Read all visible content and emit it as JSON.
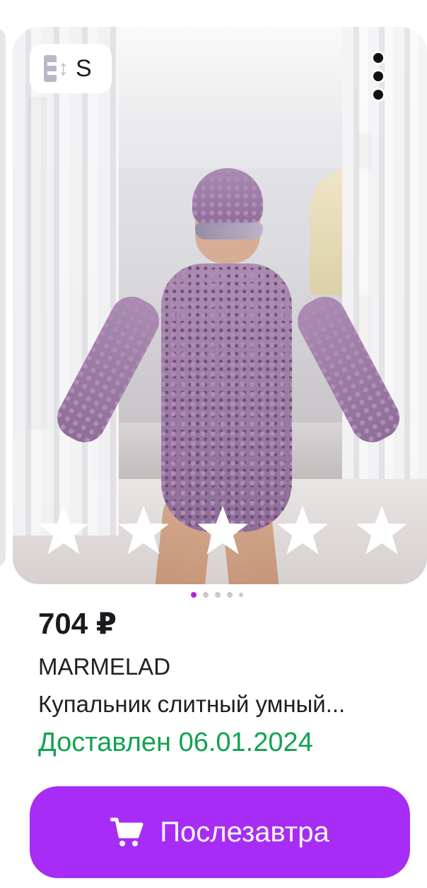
{
  "product": {
    "size_badge": "S",
    "rating_stars": 5,
    "image_count": 5,
    "active_image": 1,
    "price": "704 ₽",
    "brand": "MARMELAD",
    "title": "Купальник слитный умный...",
    "delivery_status": "Доставлен 06.01.2024"
  },
  "cart_button": {
    "label": "Послезавтра"
  },
  "colors": {
    "accent": "#a72cf5",
    "pager_active": "#b01fe0",
    "delivered_green": "#12a252"
  },
  "icons": {
    "size": "size-ruler-icon",
    "more": "more-vertical-icon",
    "cart": "cart-icon",
    "star": "star-icon"
  }
}
